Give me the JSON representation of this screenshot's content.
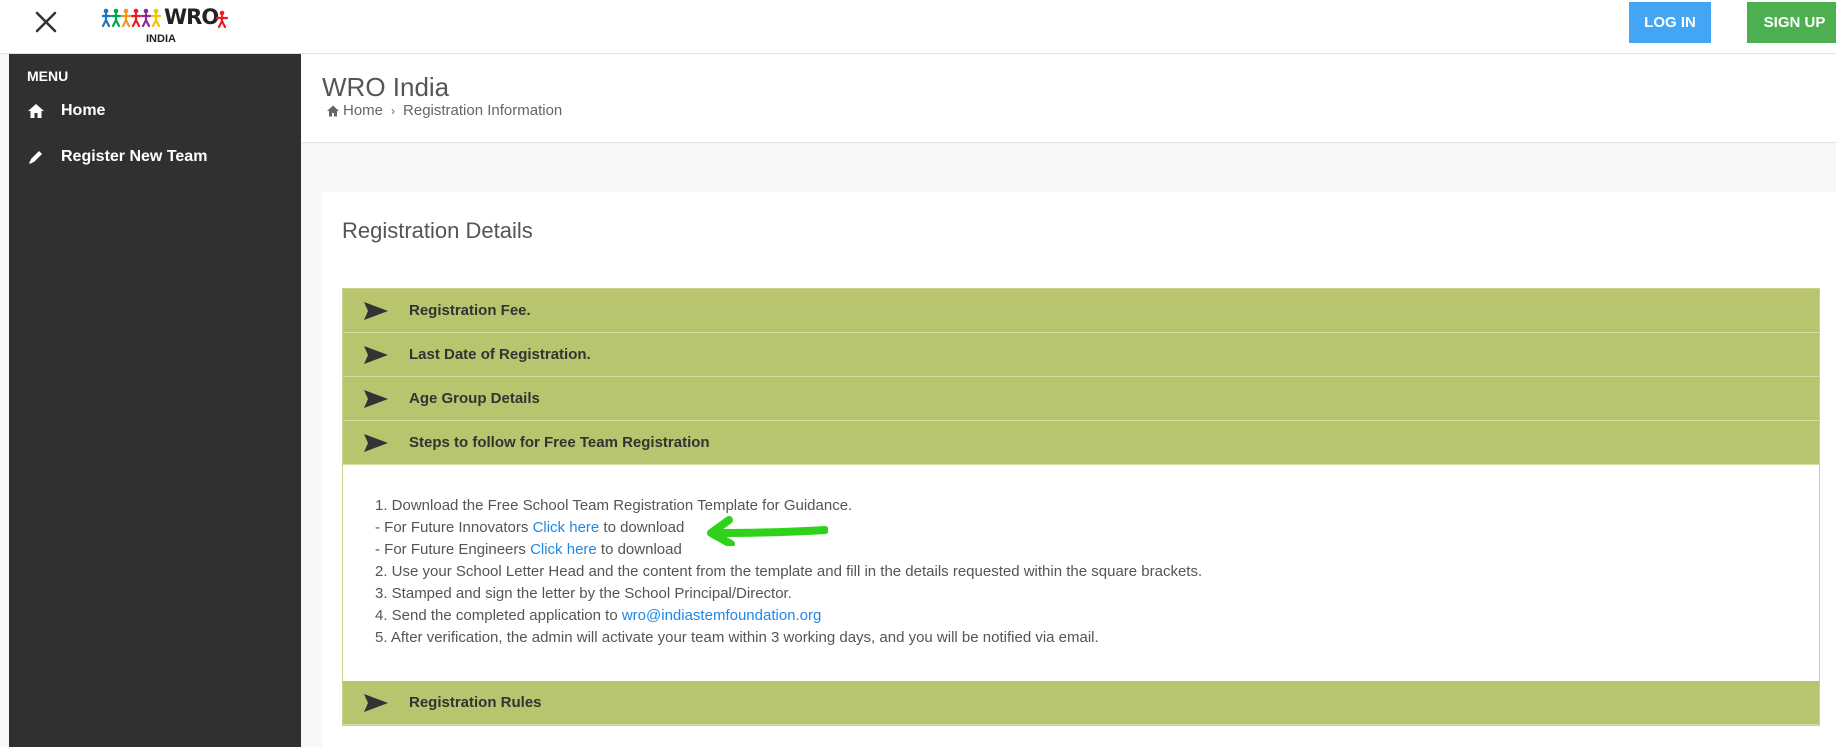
{
  "topbar": {
    "logo_text": "WRO",
    "logo_sub": "INDIA",
    "login_label": "LOG IN",
    "signup_label": "SIGN UP",
    "login_color": "#42a5f5",
    "signup_color": "#4caf50"
  },
  "sidebar": {
    "heading": "MENU",
    "items": [
      {
        "label": "Home",
        "icon": "home-icon"
      },
      {
        "label": "Register New Team",
        "icon": "pencil-icon"
      }
    ]
  },
  "header": {
    "title": "WRO India",
    "breadcrumb": [
      "Home",
      "Registration Information"
    ]
  },
  "card": {
    "title": "Registration Details",
    "accent_color": "#b9c46e",
    "sections": [
      {
        "label": "Registration Fee."
      },
      {
        "label": "Last Date of Registration."
      },
      {
        "label": "Age Group Details"
      },
      {
        "label": "Steps to follow for Free Team Registration"
      },
      {
        "label": "Registration Rules"
      }
    ],
    "steps": {
      "line1": "1. Download the Free School Team Registration Template for Guidance.",
      "innovators_prefix": "- For Future Innovators ",
      "engineers_prefix": "- For Future Engineers ",
      "link_text": "Click here",
      "download_suffix": " to download",
      "line2": "2. Use your School Letter Head and the content from the template and fill in the details requested within the square brackets.",
      "line3": "3. Stamped and sign the letter by the School Principal/Director.",
      "line4_prefix": "4. Send the completed application to ",
      "email": "wro@indiastemfoundation.org",
      "line5": "5. After verification, the admin will activate your team within 3 working days, and you will be notified via email."
    }
  }
}
